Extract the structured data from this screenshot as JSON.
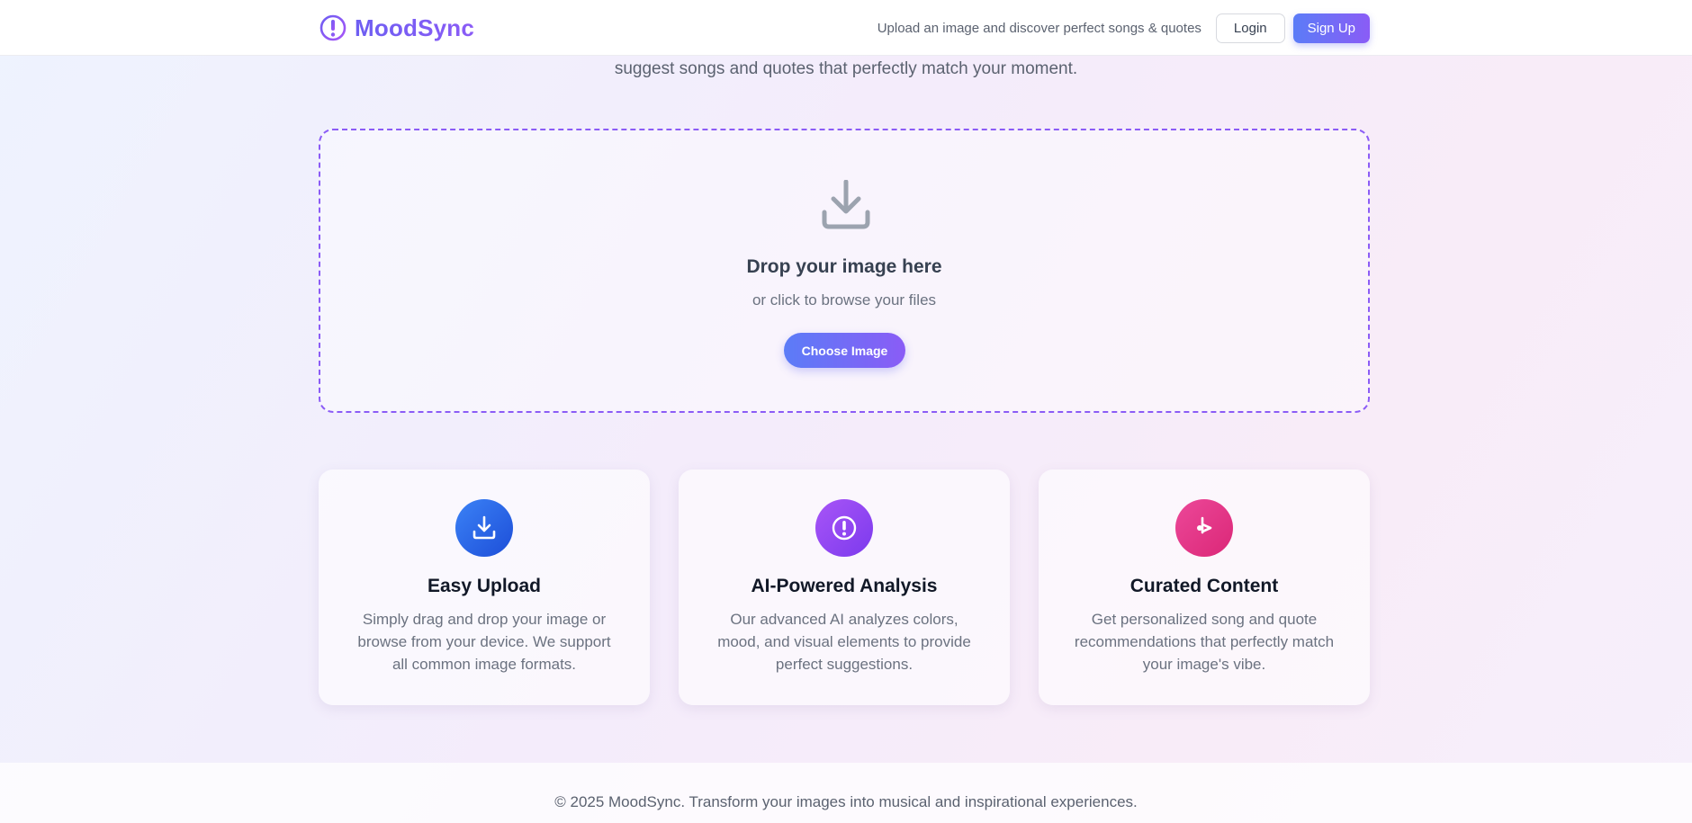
{
  "header": {
    "brand": "MoodSync",
    "brand_icon": "mood-icon",
    "tagline": "Upload an image and discover perfect songs & quotes",
    "login_label": "Login",
    "signup_label": "Sign Up"
  },
  "hero": {
    "subtitle": "suggest songs and quotes that perfectly match your moment."
  },
  "upload": {
    "icon": "download-icon",
    "title": "Drop your image here",
    "subtitle": "or click to browse your files",
    "button_label": "Choose Image"
  },
  "features": [
    {
      "icon": "upload-icon",
      "color": "#2563eb",
      "title": "Easy Upload",
      "description": "Simply drag and drop your image or browse from your device. We support all common image formats."
    },
    {
      "icon": "ai-icon",
      "color": "#8b5cf6",
      "title": "AI-Powered Analysis",
      "description": "Our advanced AI analyzes colors, mood, and visual elements to provide perfect suggestions."
    },
    {
      "icon": "music-icon",
      "color": "#ec4899",
      "title": "Curated Content",
      "description": "Get personalized song and quote recommendations that perfectly match your image's vibe."
    }
  ],
  "colors": {
    "accent_start": "#5b7cf7",
    "accent_end": "#8a5cf6",
    "dashed_border": "#8b5cf6"
  },
  "footer": {
    "text": "© 2025 MoodSync. Transform your images into musical and inspirational experiences."
  }
}
